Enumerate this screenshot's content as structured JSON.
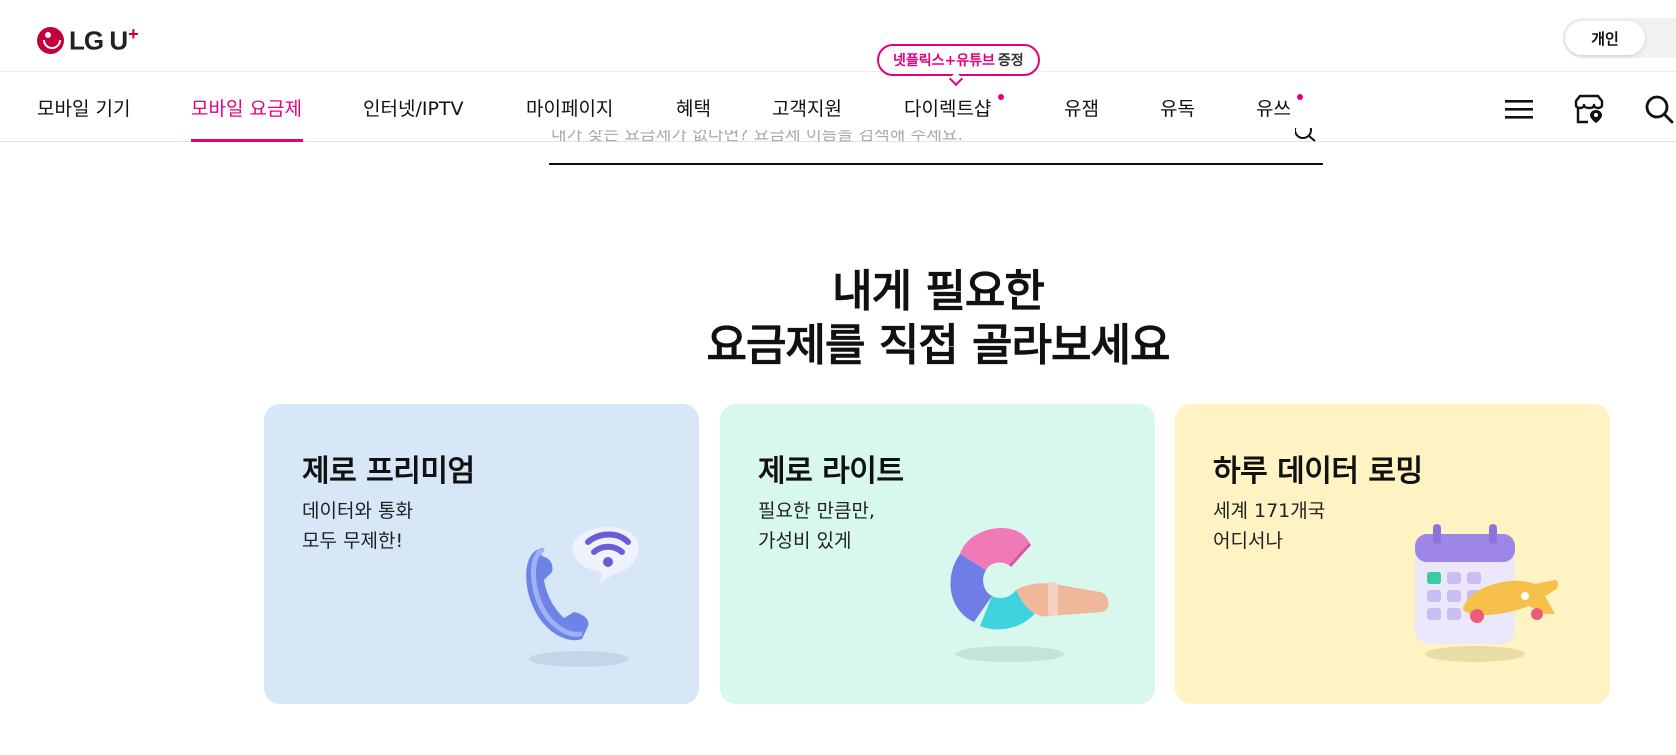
{
  "header": {
    "logo_text": "LG U",
    "logo_plus": "+",
    "mode_active": "개인"
  },
  "nav": {
    "items": [
      {
        "label": "모바일 기기"
      },
      {
        "label": "모바일 요금제"
      },
      {
        "label": "인터넷/IPTV"
      },
      {
        "label": "마이페이지"
      },
      {
        "label": "혜택"
      },
      {
        "label": "고객지원"
      },
      {
        "label": "다이렉트샵"
      },
      {
        "label": "유잼"
      },
      {
        "label": "유독"
      },
      {
        "label": "유쓰"
      }
    ],
    "active_item": "모바일 요금제",
    "promo_pink": "넷플릭스+유튜브",
    "promo_grey": "증정",
    "accent_color": "#e6007e"
  },
  "search": {
    "placeholder": "내가 찾는 요금제가 없다면? 요금제 이름을 검색해 주세요."
  },
  "main": {
    "heading_line1": "내게 필요한",
    "heading_line2": "요금제를 직접 골라보세요",
    "cards": [
      {
        "title": "제로 프리미엄",
        "desc_line1": "데이터와 통화",
        "desc_line2": "모두 무제한!",
        "bg_color": "#d8e7f8",
        "icon": "phone-wifi-icon"
      },
      {
        "title": "제로 라이트",
        "desc_line1": "필요한 만큼만,",
        "desc_line2": "가성비 있게",
        "bg_color": "#d8f8ee",
        "icon": "pie-chart-hand-icon"
      },
      {
        "title": "하루 데이터 로밍",
        "desc_line1": "세계 171개국",
        "desc_line2": "어디서나",
        "bg_color": "#fff3c4",
        "icon": "calendar-plane-icon"
      }
    ]
  }
}
